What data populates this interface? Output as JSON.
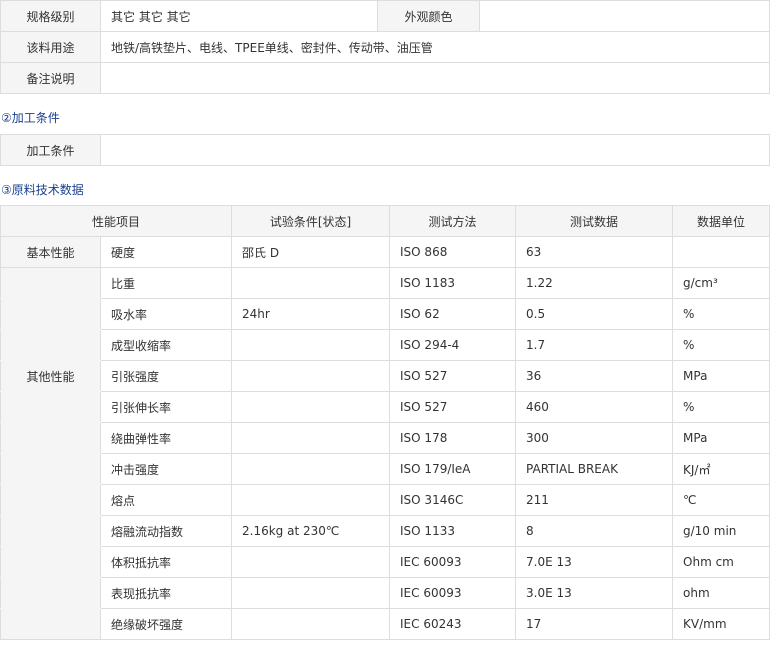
{
  "spec_table": {
    "rows": [
      {
        "label": "规格级别",
        "value": "其它 其它 其它",
        "label2": "外观颜色",
        "value2": ""
      },
      {
        "label": "该料用途",
        "value": "地铁/高铁垫片、电线、TPEE单线、密封件、传动带、油压管"
      },
      {
        "label": "备注说明",
        "value": ""
      }
    ]
  },
  "processing": {
    "title": "②加工条件",
    "label": "加工条件",
    "value": ""
  },
  "tech_data": {
    "title": "③原料技术数据",
    "headers": [
      "性能项目",
      "试验条件[状态]",
      "测试方法",
      "测试数据",
      "数据单位"
    ],
    "categories": {
      "basic": "基本性能",
      "other": "其他性能"
    },
    "rows": [
      {
        "item": "硬度",
        "condition": "邵氏 D",
        "method": "ISO 868",
        "value": "63",
        "unit": ""
      },
      {
        "item": "比重",
        "condition": "",
        "method": "ISO 1183",
        "value": "1.22",
        "unit": "g/cm³"
      },
      {
        "item": "吸水率",
        "condition": "24hr",
        "method": "ISO 62",
        "value": "0.5",
        "unit": "%"
      },
      {
        "item": "成型收缩率",
        "condition": "",
        "method": "ISO 294-4",
        "value": "1.7",
        "unit": "%"
      },
      {
        "item": "引张强度",
        "condition": "",
        "method": "ISO 527",
        "value": "36",
        "unit": "MPa"
      },
      {
        "item": "引张伸长率",
        "condition": "",
        "method": "ISO 527",
        "value": "460",
        "unit": "%"
      },
      {
        "item": "绕曲弹性率",
        "condition": "",
        "method": "ISO 178",
        "value": "300",
        "unit": "MPa"
      },
      {
        "item": "冲击强度",
        "condition": "",
        "method": "ISO 179/IeA",
        "value": "PARTIAL BREAK",
        "unit": "KJ/㎡"
      },
      {
        "item": "熔点",
        "condition": "",
        "method": "ISO 3146C",
        "value": "211",
        "unit": "℃"
      },
      {
        "item": "熔融流动指数",
        "condition": "2.16kg at 230℃",
        "method": "ISO 1133",
        "value": "8",
        "unit": "g/10 min"
      },
      {
        "item": "体积抵抗率",
        "condition": "",
        "method": "IEC 60093",
        "value": "7.0E 13",
        "unit": "Ohm cm"
      },
      {
        "item": "表现抵抗率",
        "condition": "",
        "method": "IEC 60093",
        "value": "3.0E 13",
        "unit": "ohm"
      },
      {
        "item": "绝缘破坏强度",
        "condition": "",
        "method": "IEC 60243",
        "value": "17",
        "unit": "KV/mm"
      }
    ]
  }
}
